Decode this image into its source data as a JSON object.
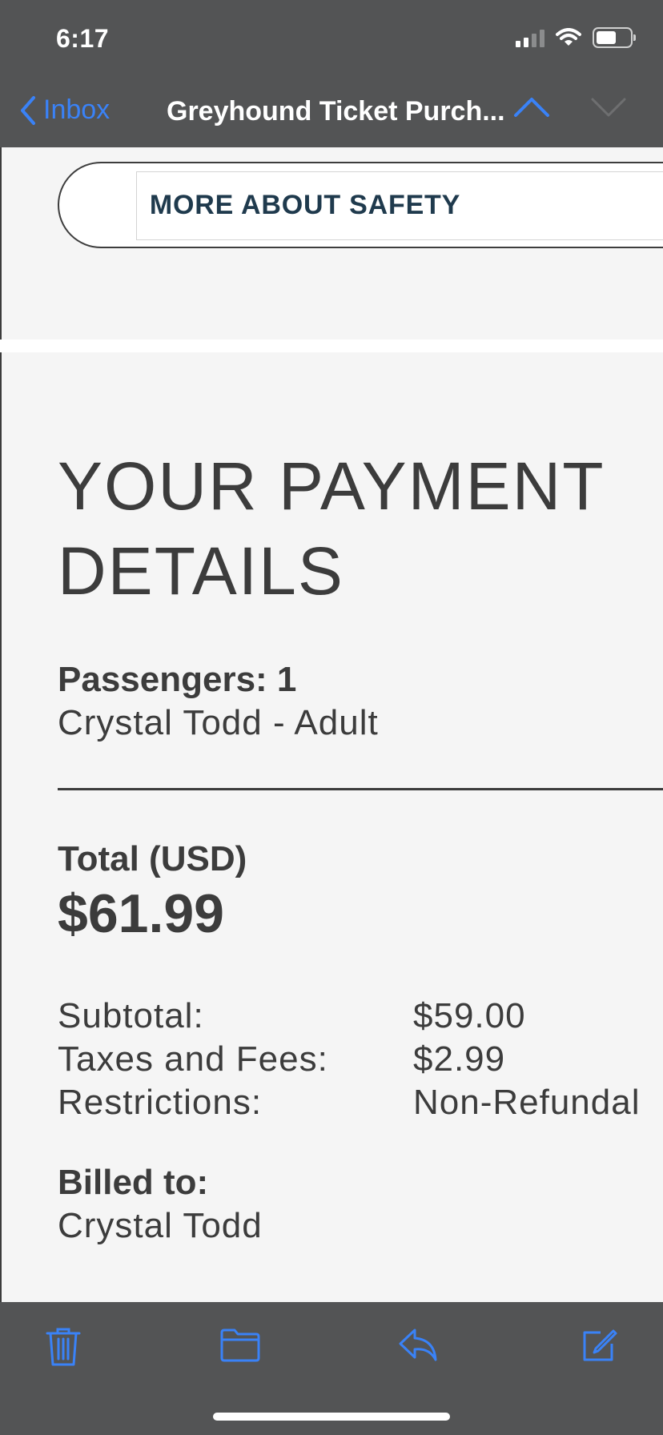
{
  "status_bar": {
    "time": "6:17"
  },
  "nav": {
    "back_label": "Inbox",
    "title": "Greyhound Ticket Purch..."
  },
  "email": {
    "safety_button_label": "MORE ABOUT SAFETY",
    "heading_line1": "YOUR PAYMENT",
    "heading_line2": "DETAILS",
    "passengers_label": "Passengers: 1",
    "passenger_name": "Crystal Todd - Adult",
    "total_label": "Total (USD)",
    "total_value": "$61.99",
    "line_items": [
      {
        "label": "Subtotal:",
        "value": "$59.00"
      },
      {
        "label": "Taxes and Fees:",
        "value": "$2.99"
      },
      {
        "label": "Restrictions:",
        "value": "Non-Refundal"
      }
    ],
    "billed_label": "Billed to:",
    "billed_name": "Crystal Todd"
  },
  "toolbar": {
    "icons": [
      "trash-icon",
      "folder-icon",
      "reply-icon",
      "compose-icon"
    ]
  },
  "colors": {
    "header_bg": "#535455",
    "accent": "#3a82f7",
    "body_bg": "#f5f5f5",
    "text": "#3c3c3c",
    "button_text": "#1f3a4d"
  }
}
